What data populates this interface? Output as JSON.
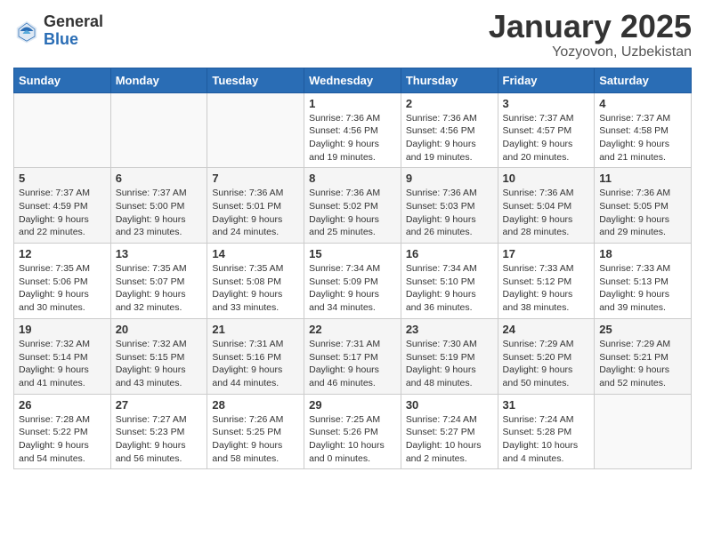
{
  "logo": {
    "general": "General",
    "blue": "Blue"
  },
  "title": "January 2025",
  "location": "Yozyovon, Uzbekistan",
  "days_header": [
    "Sunday",
    "Monday",
    "Tuesday",
    "Wednesday",
    "Thursday",
    "Friday",
    "Saturday"
  ],
  "weeks": [
    [
      {
        "day": "",
        "info": ""
      },
      {
        "day": "",
        "info": ""
      },
      {
        "day": "",
        "info": ""
      },
      {
        "day": "1",
        "info": "Sunrise: 7:36 AM\nSunset: 4:56 PM\nDaylight: 9 hours\nand 19 minutes."
      },
      {
        "day": "2",
        "info": "Sunrise: 7:36 AM\nSunset: 4:56 PM\nDaylight: 9 hours\nand 19 minutes."
      },
      {
        "day": "3",
        "info": "Sunrise: 7:37 AM\nSunset: 4:57 PM\nDaylight: 9 hours\nand 20 minutes."
      },
      {
        "day": "4",
        "info": "Sunrise: 7:37 AM\nSunset: 4:58 PM\nDaylight: 9 hours\nand 21 minutes."
      }
    ],
    [
      {
        "day": "5",
        "info": "Sunrise: 7:37 AM\nSunset: 4:59 PM\nDaylight: 9 hours\nand 22 minutes."
      },
      {
        "day": "6",
        "info": "Sunrise: 7:37 AM\nSunset: 5:00 PM\nDaylight: 9 hours\nand 23 minutes."
      },
      {
        "day": "7",
        "info": "Sunrise: 7:36 AM\nSunset: 5:01 PM\nDaylight: 9 hours\nand 24 minutes."
      },
      {
        "day": "8",
        "info": "Sunrise: 7:36 AM\nSunset: 5:02 PM\nDaylight: 9 hours\nand 25 minutes."
      },
      {
        "day": "9",
        "info": "Sunrise: 7:36 AM\nSunset: 5:03 PM\nDaylight: 9 hours\nand 26 minutes."
      },
      {
        "day": "10",
        "info": "Sunrise: 7:36 AM\nSunset: 5:04 PM\nDaylight: 9 hours\nand 28 minutes."
      },
      {
        "day": "11",
        "info": "Sunrise: 7:36 AM\nSunset: 5:05 PM\nDaylight: 9 hours\nand 29 minutes."
      }
    ],
    [
      {
        "day": "12",
        "info": "Sunrise: 7:35 AM\nSunset: 5:06 PM\nDaylight: 9 hours\nand 30 minutes."
      },
      {
        "day": "13",
        "info": "Sunrise: 7:35 AM\nSunset: 5:07 PM\nDaylight: 9 hours\nand 32 minutes."
      },
      {
        "day": "14",
        "info": "Sunrise: 7:35 AM\nSunset: 5:08 PM\nDaylight: 9 hours\nand 33 minutes."
      },
      {
        "day": "15",
        "info": "Sunrise: 7:34 AM\nSunset: 5:09 PM\nDaylight: 9 hours\nand 34 minutes."
      },
      {
        "day": "16",
        "info": "Sunrise: 7:34 AM\nSunset: 5:10 PM\nDaylight: 9 hours\nand 36 minutes."
      },
      {
        "day": "17",
        "info": "Sunrise: 7:33 AM\nSunset: 5:12 PM\nDaylight: 9 hours\nand 38 minutes."
      },
      {
        "day": "18",
        "info": "Sunrise: 7:33 AM\nSunset: 5:13 PM\nDaylight: 9 hours\nand 39 minutes."
      }
    ],
    [
      {
        "day": "19",
        "info": "Sunrise: 7:32 AM\nSunset: 5:14 PM\nDaylight: 9 hours\nand 41 minutes."
      },
      {
        "day": "20",
        "info": "Sunrise: 7:32 AM\nSunset: 5:15 PM\nDaylight: 9 hours\nand 43 minutes."
      },
      {
        "day": "21",
        "info": "Sunrise: 7:31 AM\nSunset: 5:16 PM\nDaylight: 9 hours\nand 44 minutes."
      },
      {
        "day": "22",
        "info": "Sunrise: 7:31 AM\nSunset: 5:17 PM\nDaylight: 9 hours\nand 46 minutes."
      },
      {
        "day": "23",
        "info": "Sunrise: 7:30 AM\nSunset: 5:19 PM\nDaylight: 9 hours\nand 48 minutes."
      },
      {
        "day": "24",
        "info": "Sunrise: 7:29 AM\nSunset: 5:20 PM\nDaylight: 9 hours\nand 50 minutes."
      },
      {
        "day": "25",
        "info": "Sunrise: 7:29 AM\nSunset: 5:21 PM\nDaylight: 9 hours\nand 52 minutes."
      }
    ],
    [
      {
        "day": "26",
        "info": "Sunrise: 7:28 AM\nSunset: 5:22 PM\nDaylight: 9 hours\nand 54 minutes."
      },
      {
        "day": "27",
        "info": "Sunrise: 7:27 AM\nSunset: 5:23 PM\nDaylight: 9 hours\nand 56 minutes."
      },
      {
        "day": "28",
        "info": "Sunrise: 7:26 AM\nSunset: 5:25 PM\nDaylight: 9 hours\nand 58 minutes."
      },
      {
        "day": "29",
        "info": "Sunrise: 7:25 AM\nSunset: 5:26 PM\nDaylight: 10 hours\nand 0 minutes."
      },
      {
        "day": "30",
        "info": "Sunrise: 7:24 AM\nSunset: 5:27 PM\nDaylight: 10 hours\nand 2 minutes."
      },
      {
        "day": "31",
        "info": "Sunrise: 7:24 AM\nSunset: 5:28 PM\nDaylight: 10 hours\nand 4 minutes."
      },
      {
        "day": "",
        "info": ""
      }
    ]
  ]
}
